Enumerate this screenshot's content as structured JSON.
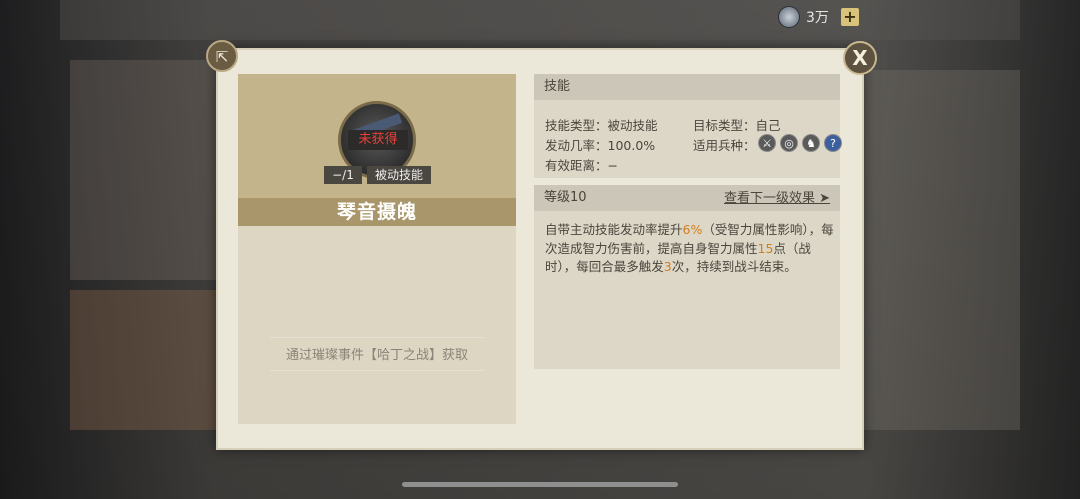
{
  "currency": {
    "amount": "3万",
    "plus": "+"
  },
  "buttons": {
    "share_icon": "share-icon",
    "close_label": "X"
  },
  "skill": {
    "status": "未获得",
    "count": "−/1",
    "type_badge": "被动技能",
    "name": "琴音摄魄",
    "source": "通过璀璨事件【哈丁之战】获取"
  },
  "details": {
    "header": "技能",
    "skill_type": "技能类型：被动技能",
    "target_type": "目标类型：自己",
    "rate": "发动几率：100.0%",
    "troops_label": "适用兵种：",
    "range": "有效距离：−",
    "troop_icons": [
      "sword-icon",
      "target-icon",
      "horse-icon",
      "question-icon"
    ]
  },
  "level": {
    "label": "等级10",
    "next": "查看下一级效果 ➤"
  },
  "description": {
    "p1": "自带主动技能发动率提升",
    "v1": "6%",
    "p2": "（受智力属性影响），每次造成智力伤害前，提高自身智力属性",
    "v2": "15",
    "p3": "点（战时），每回合最多触发",
    "v3": "3",
    "p4": "次，持续到战斗结束。"
  },
  "colors": {
    "highlight": "#d0801f",
    "panel": "#ebe7d9",
    "name_bar": "#a9966a"
  }
}
